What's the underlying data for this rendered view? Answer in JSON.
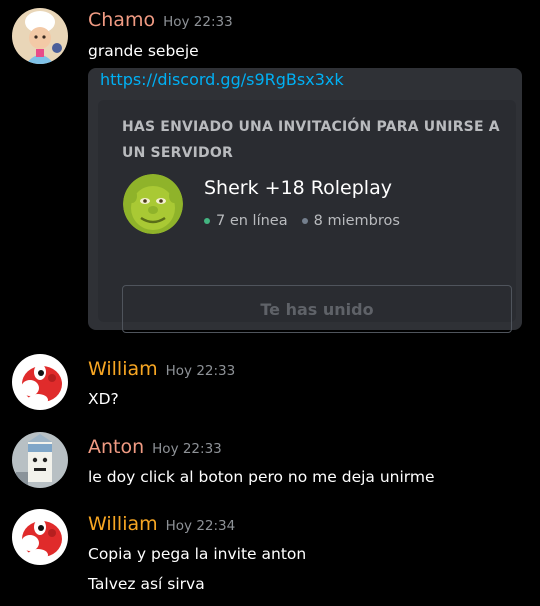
{
  "messages": [
    {
      "author": "Chamo",
      "author_color": "#f09b83",
      "timestamp": "Hoy 22:33",
      "lines": [
        "grande sebeje"
      ],
      "avatar_icon": "chef-character-avatar"
    },
    {
      "author": "William",
      "author_color": "#f7a623",
      "timestamp": "Hoy 22:33",
      "lines": [
        "XD?"
      ],
      "avatar_icon": "red-yoshi-avatar"
    },
    {
      "author": "Anton",
      "author_color": "#f09b83",
      "timestamp": "Hoy 22:33",
      "lines": [
        "le doy click al boton pero no me deja unirme"
      ],
      "avatar_icon": "milk-carton-avatar"
    },
    {
      "author": "William",
      "author_color": "#f7a623",
      "timestamp": "Hoy 22:34",
      "lines": [
        "Copia y pega la invite anton",
        "Talvez así sirva"
      ],
      "avatar_icon": "red-yoshi-avatar"
    }
  ],
  "embed": {
    "link": "https://discord.gg/s9RgBsx3xk",
    "header": "HAS ENVIADO UNA INVITACIÓN PARA UNIRSE A UN SERVIDOR",
    "guild_name": "Sherk +18 Roleplay",
    "online": "7 en línea",
    "members": "8 miembros",
    "button_label": "Te has unido",
    "guild_icon": "shrek-face-icon"
  },
  "colors": {
    "background": "#000000",
    "link": "#00b0f4",
    "online_dot": "#43b581",
    "embed_bg": "#2f3136"
  }
}
